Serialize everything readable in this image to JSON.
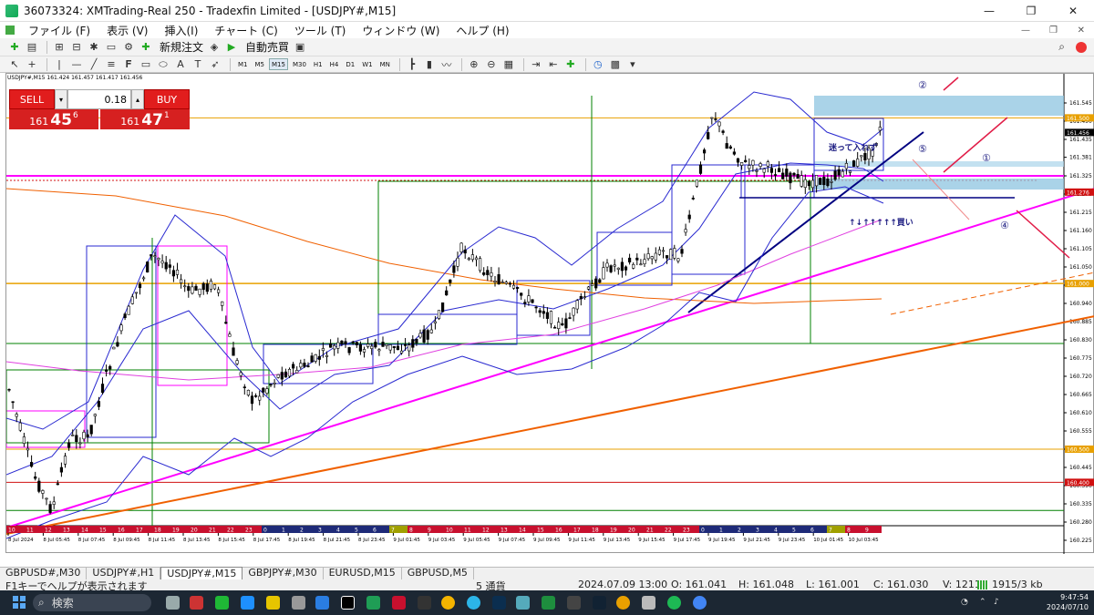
{
  "window": {
    "title": "36073324: XMTrading-Real 250 - Tradexfin Limited - [USDJPY#,M15]",
    "controls": [
      "—",
      "❐",
      "✕"
    ]
  },
  "menu": [
    "ファイル (F)",
    "表示 (V)",
    "挿入(I)",
    "チャート (C)",
    "ツール (T)",
    "ウィンドウ (W)",
    "ヘルプ (H)"
  ],
  "toolbar": {
    "new_order": "新規注文",
    "auto_trade": "自動売買",
    "timeframes": [
      "M1",
      "M5",
      "M15",
      "M30",
      "H1",
      "H4",
      "D1",
      "W1",
      "MN"
    ],
    "active_timeframe": "M15"
  },
  "chart": {
    "symbol_line": "USDJPY#,M15  161.424 161.457 161.417 161.456",
    "price_axis": [
      "161.545",
      "161.490",
      "161.435",
      "161.381",
      "161.325",
      "161.270",
      "161.215",
      "161.160",
      "161.105",
      "161.050",
      "160.995",
      "160.940",
      "160.885",
      "160.830",
      "160.775",
      "160.720",
      "160.665",
      "160.610",
      "160.555",
      "160.500",
      "160.445",
      "160.390",
      "160.335",
      "160.280",
      "160.225"
    ],
    "price_tags": [
      {
        "label": "161.500",
        "color": "#e8a000"
      },
      {
        "label": "161.456",
        "color": "#000000"
      },
      {
        "label": "161.276",
        "color": "#d01010"
      },
      {
        "label": "161.000",
        "color": "#e8a000"
      },
      {
        "label": "160.500",
        "color": "#e8a000"
      },
      {
        "label": "160.400",
        "color": "#d01010"
      }
    ],
    "time_axis": [
      "8 Jul 2024",
      "8 Jul 05:45",
      "8 Jul 07:45",
      "8 Jul 09:45",
      "8 Jul 11:45",
      "8 Jul 13:45",
      "8 Jul 15:45",
      "8 Jul 17:45",
      "8 Jul 19:45",
      "8 Jul 21:45",
      "8 Jul 23:45",
      "9 Jul 01:45",
      "9 Jul 03:45",
      "9 Jul 05:45",
      "9 Jul 07:45",
      "9 Jul 09:45",
      "9 Jul 11:45",
      "9 Jul 13:45",
      "9 Jul 15:45",
      "9 Jul 17:45",
      "9 Jul 19:45",
      "9 Jul 21:45",
      "9 Jul 23:45",
      "10 Jul 01:45",
      "10 Jul 03:45"
    ],
    "hour_strip": [
      "10",
      "11",
      "12",
      "13",
      "14",
      "15",
      "16",
      "17",
      "18",
      "19",
      "20",
      "21",
      "22",
      "23",
      "0",
      "1",
      "2",
      "3",
      "4",
      "5",
      "6",
      "7",
      "8",
      "9",
      "10",
      "11",
      "12",
      "13",
      "14",
      "15",
      "16",
      "17",
      "18",
      "19",
      "20",
      "21",
      "22",
      "23",
      "0",
      "1",
      "2",
      "3",
      "4",
      "5",
      "6",
      "7",
      "8",
      "9"
    ],
    "annotations": {
      "mayoi": "迷って入れず",
      "buy_arrows": "↑↓↑↑↑↑↑買い",
      "circle_1": "①",
      "circle_2": "②",
      "circle_4": "④",
      "circle_5": "⑤"
    }
  },
  "trade_panel": {
    "sell_label": "SELL",
    "buy_label": "BUY",
    "lot": "0.18",
    "sell_price": {
      "prefix": "161",
      "big": "45",
      "sup": "6"
    },
    "buy_price": {
      "prefix": "161",
      "big": "47",
      "sup": "1"
    }
  },
  "tabs": [
    "GBPUSD#,M30",
    "USDJPY#,H1",
    "USDJPY#,M15",
    "GBPJPY#,M30",
    "EURUSD,M15",
    "GBPUSD,M5"
  ],
  "active_tab": "USDJPY#,M15",
  "status": {
    "help": "F1キーでヘルプが表示されます",
    "preset": "5 通貨",
    "datetime": "2024.07.09 13:00",
    "open": "O: 161.041",
    "high": "H: 161.048",
    "low": "L: 161.001",
    "close": "C: 161.030",
    "volume": "V: 1211",
    "traffic": "1915/3 kb"
  },
  "taskbar": {
    "search_placeholder": "検索",
    "time": "9:47:54",
    "date": "2024/07/10"
  },
  "colors": {
    "sell_red": "#e11d1d",
    "magenta_trend": "#ff00ff",
    "orange_trend": "#f06000",
    "bollinger": "#2a2ad0",
    "level_gold": "#e8a000",
    "level_red": "#d01010",
    "level_green": "#008000"
  }
}
